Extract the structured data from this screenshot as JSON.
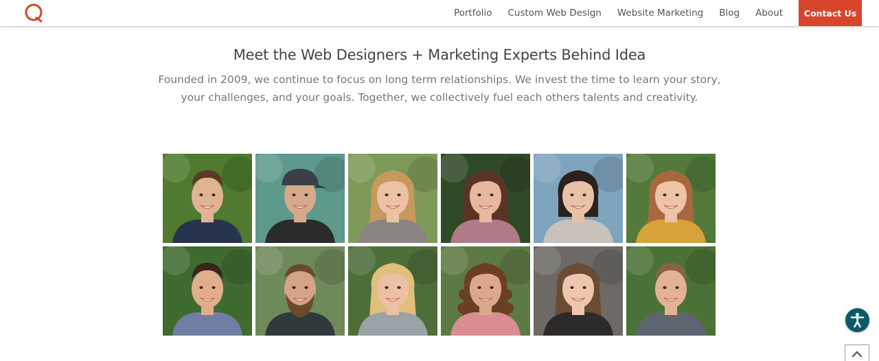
{
  "nav": {
    "links": [
      "Portfolio",
      "Custom Web Design",
      "Website Marketing",
      "Blog",
      "About"
    ],
    "cta": "Contact Us",
    "accent_color": "#d9452b"
  },
  "hero": {
    "title": "Meet the Web Designers + Marketing Experts Behind Idea",
    "description": "Founded in 2009, we continue to focus on long term relationships. We invest the time to learn your story, your challenges, and your goals. Together, we collectively fuel each others talents and creativity."
  },
  "team": {
    "photos": [
      {
        "bg": "#4f7a2f",
        "skin": "#e0b393",
        "hair": "#5a3b25",
        "shirt": "#27344d",
        "hairstyle": "short"
      },
      {
        "bg": "#5e9a8c",
        "skin": "#d7a98a",
        "hair": "#2a2a2a",
        "shirt": "#2b2b2b",
        "hairstyle": "cap"
      },
      {
        "bg": "#7e9a58",
        "skin": "#ebc2a4",
        "hair": "#c7995f",
        "shirt": "#8a8580",
        "hairstyle": "long"
      },
      {
        "bg": "#2f4a27",
        "skin": "#e6b89f",
        "hair": "#5b3426",
        "shirt": "#b07a86",
        "hairstyle": "long"
      },
      {
        "bg": "#7fa4be",
        "skin": "#e9c1a8",
        "hair": "#2b211d",
        "shirt": "#c9c2bb",
        "hairstyle": "bob"
      },
      {
        "bg": "#537a3b",
        "skin": "#eec3a6",
        "hair": "#a8683e",
        "shirt": "#d5a33a",
        "hairstyle": "long"
      },
      {
        "bg": "#3f6b31",
        "skin": "#e1ae8c",
        "hair": "#3a2518",
        "shirt": "#6f7fa3",
        "hairstyle": "short"
      },
      {
        "bg": "#6f8a5a",
        "skin": "#d5a385",
        "hair": "#6b4a2c",
        "shirt": "#2e3a3c",
        "hairstyle": "beard"
      },
      {
        "bg": "#4d6e39",
        "skin": "#ecc0a2",
        "hair": "#e0bf7d",
        "shirt": "#9ba2a8",
        "hairstyle": "long"
      },
      {
        "bg": "#5d7a45",
        "skin": "#dba88d",
        "hair": "#6c3f22",
        "shirt": "#d98c92",
        "hairstyle": "curly"
      },
      {
        "bg": "#6d6a66",
        "skin": "#eec6ae",
        "hair": "#6a4b34",
        "shirt": "#2d2b2a",
        "hairstyle": "long"
      },
      {
        "bg": "#4b7236",
        "skin": "#e3b294",
        "hair": "#8a6340",
        "shirt": "#5c6670",
        "hairstyle": "short"
      }
    ]
  },
  "widgets": {
    "accessibility_color": "#0d5a67",
    "accessibility_icon": "accessibility-icon",
    "scroll_top_icon": "chevron-up-icon"
  }
}
